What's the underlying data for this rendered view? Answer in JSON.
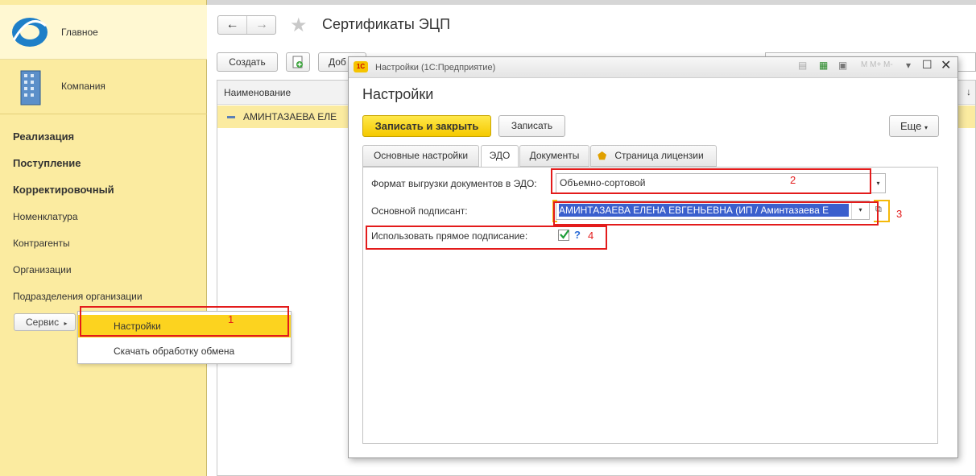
{
  "sidebar": {
    "main_label": "Главное",
    "company_label": "Компания",
    "items": [
      {
        "label": "Реализация",
        "bold": true
      },
      {
        "label": "Поступление",
        "bold": true
      },
      {
        "label": "Корректировочный",
        "bold": true
      },
      {
        "label": "Номенклатура",
        "bold": false
      },
      {
        "label": "Контрагенты",
        "bold": false
      },
      {
        "label": "Организации",
        "bold": false
      },
      {
        "label": "Подразделения организации",
        "bold": false
      }
    ],
    "service_label": "Сервис"
  },
  "popup_menu": {
    "items": [
      "Настройки",
      "Скачать обработку обмена"
    ]
  },
  "main": {
    "title": "Сертификаты ЭЦП",
    "create_label": "Создать",
    "add_label": "Доб",
    "column_name": "Наименование",
    "row_text": "АМИНТАЗАЕВА ЕЛЕ"
  },
  "dialog": {
    "window_title": "Настройки (1С:Предприятие)",
    "heading": "Настройки",
    "save_close_label": "Записать и закрыть",
    "save_label": "Записать",
    "more_label": "Еще",
    "tabs": [
      "Основные настройки",
      "ЭДО",
      "Документы",
      "Страница лицензии"
    ],
    "format_label": "Формат выгрузки документов в ЭДО:",
    "format_value": "Объемно-сортовой",
    "signer_label": "Основной подписант:",
    "signer_value": "АМИНТАЗАЕВА ЕЛЕНА ЕВГЕНЬЕВНА (ИП / Аминтазаева Е",
    "direct_sign_label": "Использовать прямое подписание:",
    "direct_sign_checked": true,
    "help_label": "?"
  },
  "annotations": [
    "1",
    "2",
    "3",
    "4"
  ],
  "colors": {
    "sidebar_bg": "#fbeba0",
    "accent_yellow": "#f5c900",
    "annotation_red": "#e31b1b",
    "selection_blue": "#3a5fcd",
    "frame_orange": "#f5b90a"
  }
}
